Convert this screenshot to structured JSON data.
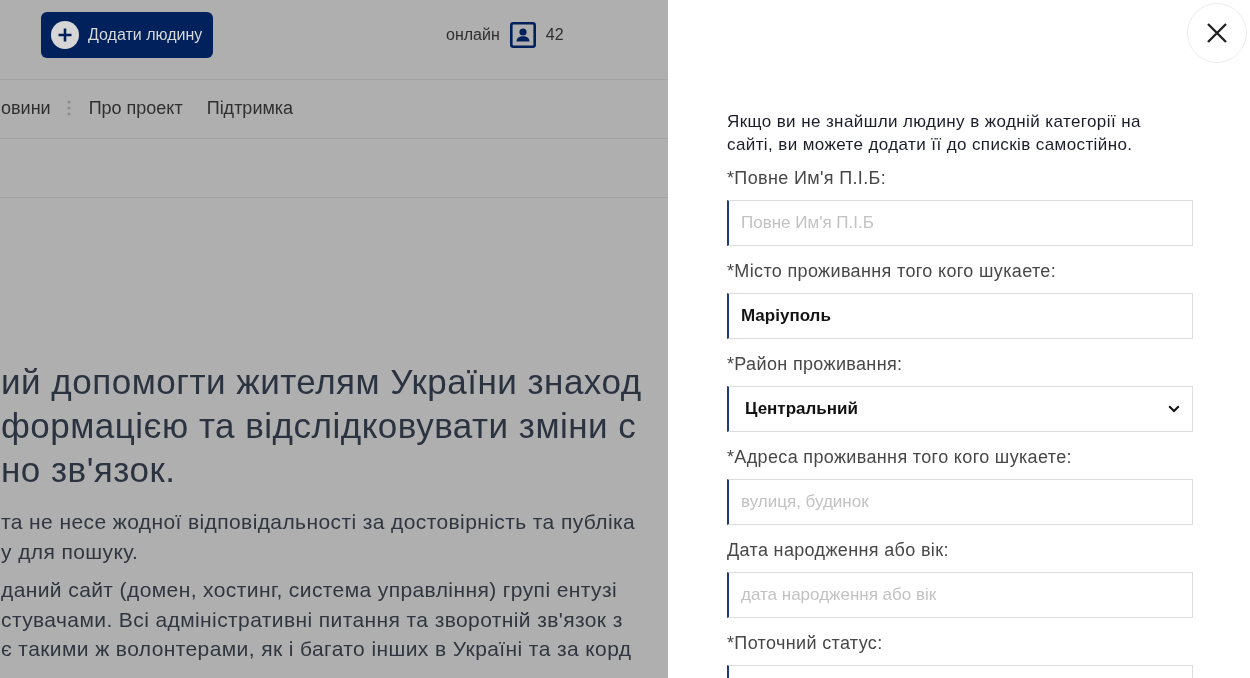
{
  "page": {
    "dimmed": true
  },
  "header": {
    "add_button": {
      "label": "Додати людину"
    },
    "online": {
      "label": "онлайн",
      "count": "42"
    }
  },
  "nav": {
    "items": [
      {
        "label": "овини",
        "separator_after": true
      },
      {
        "label": "Про проект",
        "separator_after": false
      },
      {
        "label": "Підтримка",
        "separator_after": false
      }
    ]
  },
  "hero": {
    "heading_lines": [
      "ий допомогти жителям України знаход",
      "формацією та відслідковувати зміни с",
      "но зв'язок."
    ],
    "paragraphs": [
      [
        "та не несе жодної відповідальності за достовірність та публіка",
        "у для пошуку."
      ],
      [
        "даний сайт (домен, хостинг, система управління) групі ентузі",
        "стувачами. Всі адміністративні питання та зворотній зв'язок з",
        "є такими ж волонтерами, як і багато інших в Україні та за корд"
      ]
    ]
  },
  "drawer": {
    "intro": "Якщо ви не знайшли людину в жодній категорії на сайті, ви можете додати її до списків самостійно.",
    "fields": [
      {
        "label": "*Повне Им'я П.І.Б:",
        "kind": "input",
        "placeholder": "Повне Им'я П.І.Б"
      },
      {
        "label": "*Місто проживання того кого шукаете:",
        "kind": "input",
        "value": "Маріуполь"
      },
      {
        "label": "*Район проживання:",
        "kind": "select",
        "value": "Центральний"
      },
      {
        "label": "*Адреса проживання того кого шукаете:",
        "kind": "input",
        "placeholder": "вулиця, будинок"
      },
      {
        "label": "Дата народження або вік:",
        "kind": "input",
        "placeholder": "дата народження або вік"
      },
      {
        "label": "*Поточний статус:",
        "kind": "input"
      }
    ]
  }
}
